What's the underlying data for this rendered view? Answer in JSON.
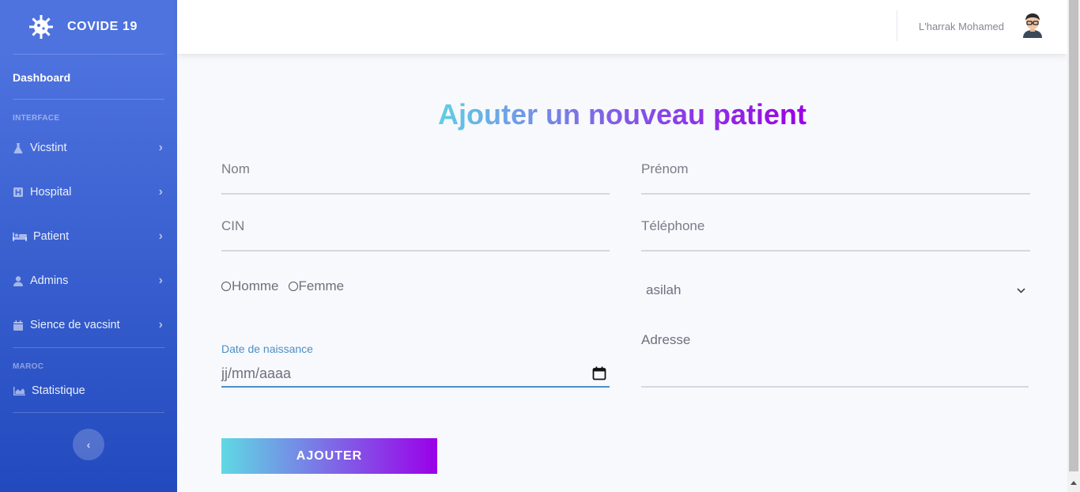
{
  "brand": {
    "name": "COVIDE 19",
    "icon": "virus-icon"
  },
  "sidebar": {
    "dashboard": "Dashboard",
    "heading_interface": "INTERFACE",
    "items": [
      {
        "label": "Vicstint",
        "icon": "flask-icon"
      },
      {
        "label": "Hospital",
        "icon": "hospital-icon"
      },
      {
        "label": "Patient",
        "icon": "bed-icon"
      },
      {
        "label": "Admins",
        "icon": "user-icon"
      },
      {
        "label": "Sience de vacsint",
        "icon": "calendar-icon"
      }
    ],
    "heading_maroc": "MAROC",
    "statistique": {
      "label": "Statistique",
      "icon": "chart-area-icon"
    },
    "toggle_icon": "chevron-left-icon"
  },
  "topbar": {
    "username": "L'harrak Mohamed",
    "avatar_icon": "avatar-icon"
  },
  "form": {
    "title": "Ajouter un nouveau patient",
    "nom_placeholder": "Nom",
    "prenom_placeholder": "Prénom",
    "cin_placeholder": "CIN",
    "telephone_placeholder": "Téléphone",
    "gender_options": [
      "Homme",
      "Femme"
    ],
    "city_selected": "asilah",
    "date_label": "Date de naissance",
    "date_value": "jj/mm/aaaa",
    "adresse_label": "Adresse",
    "submit_label": "AJOUTER"
  },
  "colors": {
    "sidebar_top": "#4e73df",
    "sidebar_bottom": "#224abe",
    "gradient_start": "#5fd0e4",
    "gradient_end": "#9b00e6",
    "date_accent": "#4a8fc7"
  }
}
